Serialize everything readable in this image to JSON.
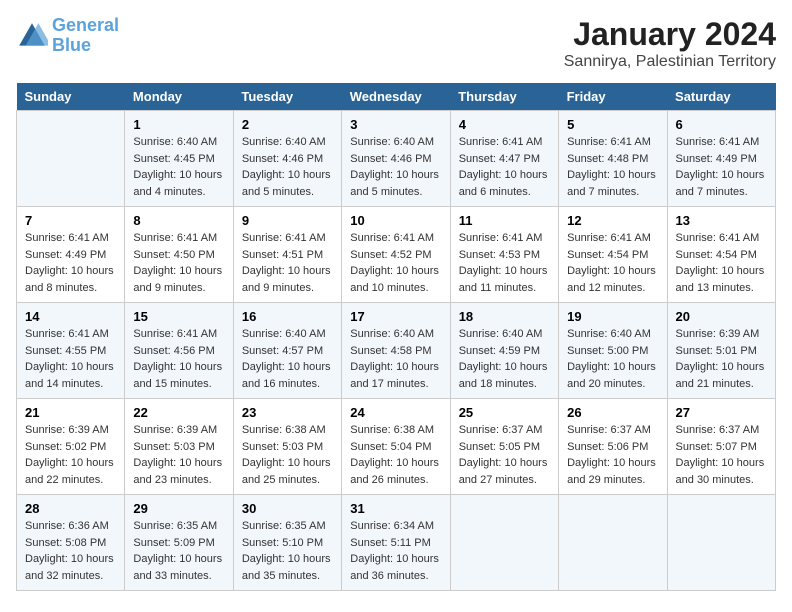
{
  "logo": {
    "text_general": "General",
    "text_blue": "Blue"
  },
  "title": "January 2024",
  "subtitle": "Sannirya, Palestinian Territory",
  "days_header": [
    "Sunday",
    "Monday",
    "Tuesday",
    "Wednesday",
    "Thursday",
    "Friday",
    "Saturday"
  ],
  "weeks": [
    [
      {
        "day": "",
        "info": ""
      },
      {
        "day": "1",
        "info": "Sunrise: 6:40 AM\nSunset: 4:45 PM\nDaylight: 10 hours\nand 4 minutes."
      },
      {
        "day": "2",
        "info": "Sunrise: 6:40 AM\nSunset: 4:46 PM\nDaylight: 10 hours\nand 5 minutes."
      },
      {
        "day": "3",
        "info": "Sunrise: 6:40 AM\nSunset: 4:46 PM\nDaylight: 10 hours\nand 5 minutes."
      },
      {
        "day": "4",
        "info": "Sunrise: 6:41 AM\nSunset: 4:47 PM\nDaylight: 10 hours\nand 6 minutes."
      },
      {
        "day": "5",
        "info": "Sunrise: 6:41 AM\nSunset: 4:48 PM\nDaylight: 10 hours\nand 7 minutes."
      },
      {
        "day": "6",
        "info": "Sunrise: 6:41 AM\nSunset: 4:49 PM\nDaylight: 10 hours\nand 7 minutes."
      }
    ],
    [
      {
        "day": "7",
        "info": "Sunrise: 6:41 AM\nSunset: 4:49 PM\nDaylight: 10 hours\nand 8 minutes."
      },
      {
        "day": "8",
        "info": "Sunrise: 6:41 AM\nSunset: 4:50 PM\nDaylight: 10 hours\nand 9 minutes."
      },
      {
        "day": "9",
        "info": "Sunrise: 6:41 AM\nSunset: 4:51 PM\nDaylight: 10 hours\nand 9 minutes."
      },
      {
        "day": "10",
        "info": "Sunrise: 6:41 AM\nSunset: 4:52 PM\nDaylight: 10 hours\nand 10 minutes."
      },
      {
        "day": "11",
        "info": "Sunrise: 6:41 AM\nSunset: 4:53 PM\nDaylight: 10 hours\nand 11 minutes."
      },
      {
        "day": "12",
        "info": "Sunrise: 6:41 AM\nSunset: 4:54 PM\nDaylight: 10 hours\nand 12 minutes."
      },
      {
        "day": "13",
        "info": "Sunrise: 6:41 AM\nSunset: 4:54 PM\nDaylight: 10 hours\nand 13 minutes."
      }
    ],
    [
      {
        "day": "14",
        "info": "Sunrise: 6:41 AM\nSunset: 4:55 PM\nDaylight: 10 hours\nand 14 minutes."
      },
      {
        "day": "15",
        "info": "Sunrise: 6:41 AM\nSunset: 4:56 PM\nDaylight: 10 hours\nand 15 minutes."
      },
      {
        "day": "16",
        "info": "Sunrise: 6:40 AM\nSunset: 4:57 PM\nDaylight: 10 hours\nand 16 minutes."
      },
      {
        "day": "17",
        "info": "Sunrise: 6:40 AM\nSunset: 4:58 PM\nDaylight: 10 hours\nand 17 minutes."
      },
      {
        "day": "18",
        "info": "Sunrise: 6:40 AM\nSunset: 4:59 PM\nDaylight: 10 hours\nand 18 minutes."
      },
      {
        "day": "19",
        "info": "Sunrise: 6:40 AM\nSunset: 5:00 PM\nDaylight: 10 hours\nand 20 minutes."
      },
      {
        "day": "20",
        "info": "Sunrise: 6:39 AM\nSunset: 5:01 PM\nDaylight: 10 hours\nand 21 minutes."
      }
    ],
    [
      {
        "day": "21",
        "info": "Sunrise: 6:39 AM\nSunset: 5:02 PM\nDaylight: 10 hours\nand 22 minutes."
      },
      {
        "day": "22",
        "info": "Sunrise: 6:39 AM\nSunset: 5:03 PM\nDaylight: 10 hours\nand 23 minutes."
      },
      {
        "day": "23",
        "info": "Sunrise: 6:38 AM\nSunset: 5:03 PM\nDaylight: 10 hours\nand 25 minutes."
      },
      {
        "day": "24",
        "info": "Sunrise: 6:38 AM\nSunset: 5:04 PM\nDaylight: 10 hours\nand 26 minutes."
      },
      {
        "day": "25",
        "info": "Sunrise: 6:37 AM\nSunset: 5:05 PM\nDaylight: 10 hours\nand 27 minutes."
      },
      {
        "day": "26",
        "info": "Sunrise: 6:37 AM\nSunset: 5:06 PM\nDaylight: 10 hours\nand 29 minutes."
      },
      {
        "day": "27",
        "info": "Sunrise: 6:37 AM\nSunset: 5:07 PM\nDaylight: 10 hours\nand 30 minutes."
      }
    ],
    [
      {
        "day": "28",
        "info": "Sunrise: 6:36 AM\nSunset: 5:08 PM\nDaylight: 10 hours\nand 32 minutes."
      },
      {
        "day": "29",
        "info": "Sunrise: 6:35 AM\nSunset: 5:09 PM\nDaylight: 10 hours\nand 33 minutes."
      },
      {
        "day": "30",
        "info": "Sunrise: 6:35 AM\nSunset: 5:10 PM\nDaylight: 10 hours\nand 35 minutes."
      },
      {
        "day": "31",
        "info": "Sunrise: 6:34 AM\nSunset: 5:11 PM\nDaylight: 10 hours\nand 36 minutes."
      },
      {
        "day": "",
        "info": ""
      },
      {
        "day": "",
        "info": ""
      },
      {
        "day": "",
        "info": ""
      }
    ]
  ]
}
